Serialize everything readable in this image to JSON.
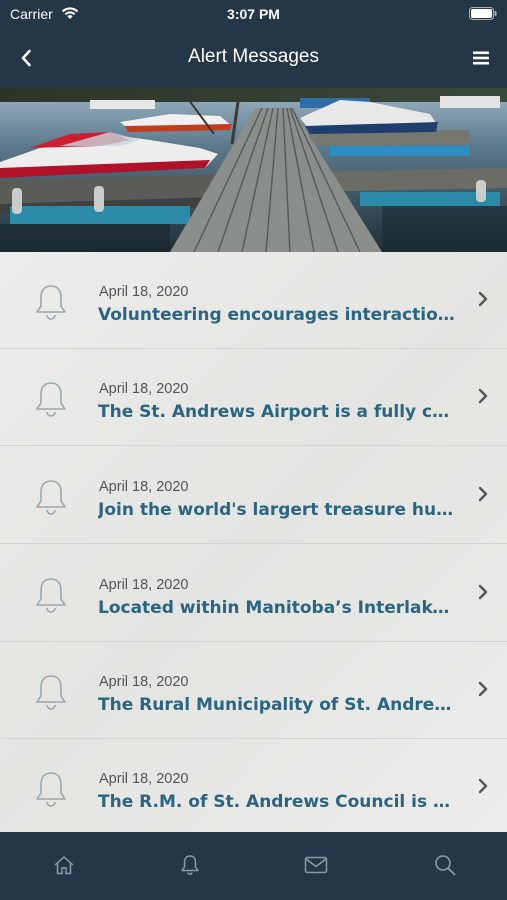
{
  "status_bar": {
    "carrier": "Carrier",
    "time": "3:07 PM"
  },
  "nav": {
    "title": "Alert Messages"
  },
  "alerts": [
    {
      "date": "April 18, 2020",
      "title": "Volunteering encourages interaction b..."
    },
    {
      "date": "April 18, 2020",
      "title": "The St. Andrews Airport is a fully contr..."
    },
    {
      "date": "April 18, 2020",
      "title": "Join the world's largert treasure hunt! ..."
    },
    {
      "date": "April 18, 2020",
      "title": "Located within Manitoba’s Interlake R..."
    },
    {
      "date": "April 18, 2020",
      "title": "The Rural Municipality of St. Andrews i..."
    },
    {
      "date": "April 18, 2020",
      "title": "The R.M. of St. Andrews Council is elect..."
    }
  ],
  "tabs": [
    {
      "icon": "home-icon"
    },
    {
      "icon": "bell-icon"
    },
    {
      "icon": "mail-icon"
    },
    {
      "icon": "search-icon"
    }
  ],
  "colors": {
    "bar": "#253746",
    "accent": "#2a6584",
    "icon": "#9aa7ae"
  }
}
